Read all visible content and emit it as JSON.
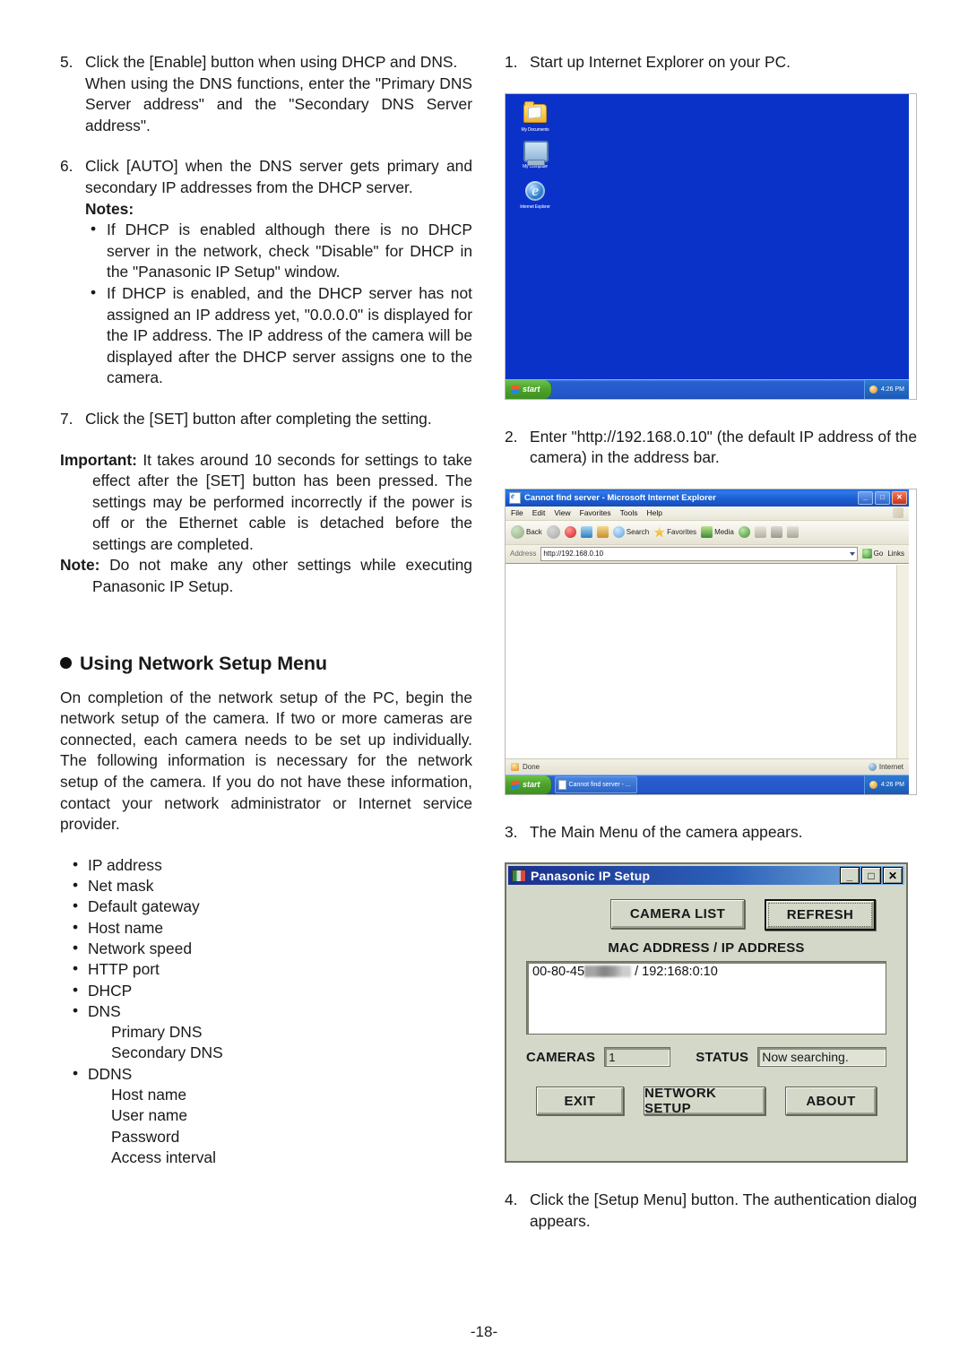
{
  "page": {
    "number": "-18-"
  },
  "left_column": {
    "step5": {
      "num": "5.",
      "line1": "Click the [Enable] button when using DHCP and DNS.",
      "line2": "When using the DNS functions, enter the \"Primary DNS Server address\" and the \"Secondary DNS Server address\"."
    },
    "step6": {
      "num": "6.",
      "text": "Click [AUTO] when the DNS server gets primary and secondary IP addresses from the DHCP server."
    },
    "notes_label": "Notes:",
    "notes": [
      "If DHCP is enabled although there is no DHCP server in the network, check \"Disable\" for DHCP in the \"Panasonic IP Setup\" window.",
      "If DHCP is enabled, and the DHCP server has not assigned an IP address yet, \"0.0.0.0\" is displayed for the IP address. The IP address of the camera will be displayed after the DHCP server assigns one to the camera."
    ],
    "step7": {
      "num": "7.",
      "text": "Click the [SET] button after completing the setting."
    },
    "important": {
      "label": "Important:",
      "text": "It takes around 10 seconds for settings to take effect after the [SET] button has been pressed. The settings may be performed incorrectly if the power is off or the Ethernet cable is detached before the settings are completed."
    },
    "note": {
      "label": "Note:",
      "text": "Do not make any other settings while executing Panasonic IP Setup."
    },
    "heading": "Using Network Setup Menu",
    "intro": "On completion of the network setup of the PC, begin the network setup of the camera. If two or more cameras are connected, each camera needs to be set up individually. The following information is necessary for the network setup of the camera. If you do not have these information, contact your network administrator or Internet service provider.",
    "settings_list": [
      {
        "label": "IP address",
        "sub": []
      },
      {
        "label": "Net mask",
        "sub": []
      },
      {
        "label": "Default gateway",
        "sub": []
      },
      {
        "label": "Host name",
        "sub": []
      },
      {
        "label": "Network speed",
        "sub": []
      },
      {
        "label": "HTTP port",
        "sub": []
      },
      {
        "label": "DHCP",
        "sub": []
      },
      {
        "label": "DNS",
        "sub": [
          "Primary DNS",
          "Secondary DNS"
        ]
      },
      {
        "label": "DDNS",
        "sub": [
          "Host name",
          "User name",
          "Password",
          "Access interval"
        ]
      }
    ]
  },
  "right_column": {
    "step1": {
      "num": "1.",
      "text": "Start up Internet Explorer on your PC."
    },
    "step2": {
      "num": "2.",
      "text": "Enter \"http://192.168.0.10\" (the default IP address of the camera) in the address bar."
    },
    "step3": {
      "num": "3.",
      "text": "The Main Menu of the camera appears."
    },
    "step4": {
      "num": "4.",
      "text": "Click the [Setup Menu] button. The authentication dialog appears."
    }
  },
  "desktop_screenshot": {
    "icons": [
      {
        "name": "My Documents",
        "icon": "folder-icon"
      },
      {
        "name": "My Computer",
        "icon": "computer-icon"
      },
      {
        "name": "Internet Explorer",
        "icon": "internet-explorer-icon"
      }
    ],
    "start_button": "start",
    "clock": "4:26 PM",
    "wallpaper_color": "#0b32c8"
  },
  "ie_window": {
    "title": "Cannot find server - Microsoft Internet Explorer",
    "window_buttons": {
      "minimize": "_",
      "maximize": "□",
      "close": "✕"
    },
    "menu": [
      "File",
      "Edit",
      "View",
      "Favorites",
      "Tools",
      "Help"
    ],
    "toolbar": [
      {
        "label": "Back",
        "icon": "back-arrow-icon"
      },
      {
        "label": "Forward",
        "icon": "forward-arrow-icon"
      },
      {
        "label": "",
        "icon": "stop-icon"
      },
      {
        "label": "",
        "icon": "refresh-icon"
      },
      {
        "label": "",
        "icon": "home-icon"
      },
      {
        "label": "Search",
        "icon": "search-icon"
      },
      {
        "label": "Favorites",
        "icon": "favorites-star-icon"
      },
      {
        "label": "Media",
        "icon": "media-icon"
      },
      {
        "label": "",
        "icon": "history-icon"
      },
      {
        "label": "",
        "icon": "mail-icon"
      },
      {
        "label": "",
        "icon": "print-icon"
      },
      {
        "label": "",
        "icon": "edit-icon"
      }
    ],
    "address_label": "Address",
    "address_value": "http://192.168.0.10",
    "go_label": "Go",
    "links_label": "Links",
    "status_left": "Done",
    "status_zone": "Internet",
    "taskbar_item": "Cannot find server - ...",
    "start_button": "start",
    "clock": "4:26 PM"
  },
  "ip_setup_dialog": {
    "title": "Panasonic IP Setup",
    "window_buttons": {
      "minimize": "_",
      "maximize": "□",
      "close": "✕"
    },
    "camera_list_button": "CAMERA LIST",
    "refresh_button": "REFRESH",
    "list_header": "MAC ADDRESS / IP ADDRESS",
    "list_rows": [
      {
        "mac_prefix": "00-80-45",
        "separator": "/",
        "ip": "192:168:0:10"
      }
    ],
    "cameras_label": "CAMERAS",
    "cameras_value": "1",
    "status_label": "STATUS",
    "status_value": "Now searching.",
    "buttons": [
      "EXIT",
      "NETWORK SETUP",
      "ABOUT"
    ]
  }
}
